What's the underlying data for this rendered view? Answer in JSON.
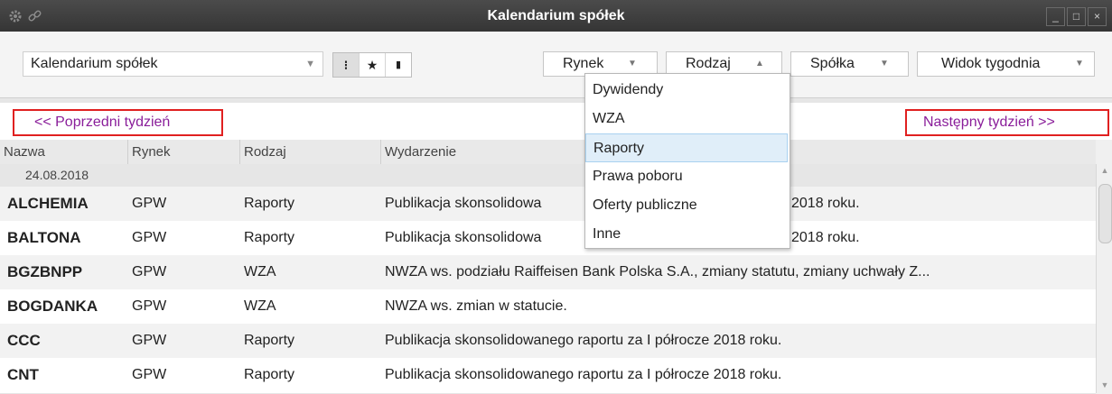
{
  "window": {
    "title": "Kalendarium spółek",
    "icons": [
      "gear-icon",
      "link-icon"
    ],
    "controls": [
      "_",
      "□",
      "×"
    ]
  },
  "toolbar": {
    "view_select": {
      "value": "Kalendarium spółek",
      "arrow": "▼"
    },
    "view_buttons": [
      {
        "icon": "list-icon",
        "glyph": "⁝"
      },
      {
        "icon": "star-icon",
        "glyph": "★"
      },
      {
        "icon": "columns-icon",
        "glyph": "▮"
      }
    ],
    "filters": [
      {
        "label": "Rynek",
        "arrow": "▼"
      },
      {
        "label": "Rodzaj",
        "arrow": "▲"
      },
      {
        "label": "Spółka",
        "arrow": "▼"
      },
      {
        "label": "Widok tygodnia",
        "arrow": "▼"
      }
    ]
  },
  "nav": {
    "prev": "<< Poprzedni tydzień",
    "next": "Następny tydzień >>"
  },
  "grid": {
    "headers": [
      "Nazwa",
      "Rynek",
      "Rodzaj",
      "Wydarzenie"
    ],
    "group_date": "24.08.2018",
    "rows": [
      {
        "name": "ALCHEMIA",
        "market": "GPW",
        "type": "Raporty",
        "event": "Publikacja skonsolidowa",
        "event_tail": "2018 roku."
      },
      {
        "name": "BALTONA",
        "market": "GPW",
        "type": "Raporty",
        "event": "Publikacja skonsolidowa",
        "event_tail": "2018 roku."
      },
      {
        "name": "BGZBNPP",
        "market": "GPW",
        "type": "WZA",
        "event": "NWZA ws. podziału Raiffeisen Bank Polska S.A., zmiany statutu, zmiany uchwały Z..."
      },
      {
        "name": "BOGDANKA",
        "market": "GPW",
        "type": "WZA",
        "event": "NWZA ws. zmian w statucie."
      },
      {
        "name": "CCC",
        "market": "GPW",
        "type": "Raporty",
        "event": "Publikacja skonsolidowanego raportu za I półrocze 2018 roku."
      },
      {
        "name": "CNT",
        "market": "GPW",
        "type": "Raporty",
        "event": "Publikacja skonsolidowanego raportu za I półrocze 2018 roku."
      }
    ]
  },
  "dropdown": {
    "items": [
      "Dywidendy",
      "WZA",
      "Raporty",
      "Prawa poboru",
      "Oferty publiczne",
      "Inne"
    ],
    "selected": "Raporty"
  },
  "colors": {
    "titlebar": "#3c3c3c",
    "link": "#8a1e9a",
    "highlight_border": "#e02020",
    "selected_item": "#e0eef9"
  }
}
